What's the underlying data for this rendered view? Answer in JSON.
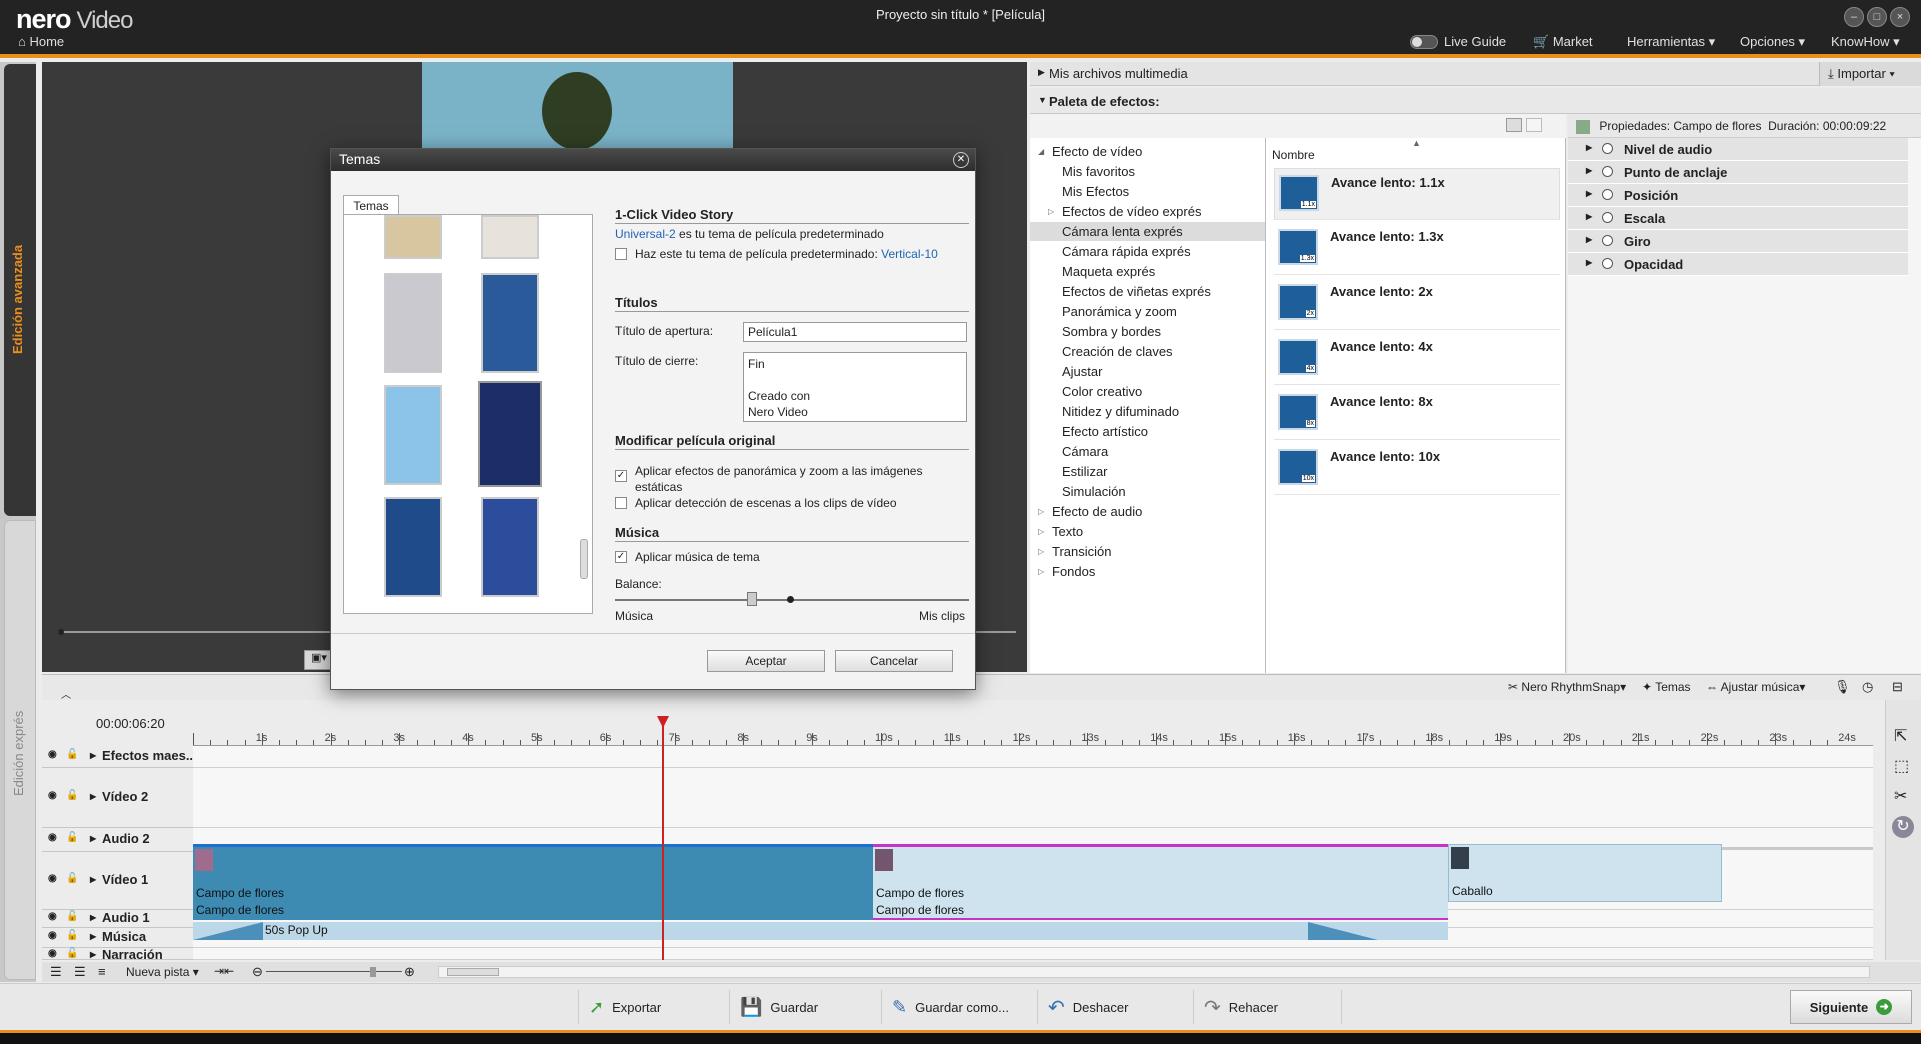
{
  "app": {
    "brand": "nero",
    "product": "Video",
    "home": "Home",
    "window_title": "Proyecto sin título * [Película]"
  },
  "topbar": {
    "live_guide": "Live Guide",
    "market": "Market",
    "tools": "Herramientas",
    "options": "Opciones",
    "knowhow": "KnowHow"
  },
  "left_tabs": {
    "advanced": "Edición avanzada",
    "express": "Edición exprés"
  },
  "media": {
    "title": "Mis archivos multimedia",
    "import": "Importar"
  },
  "effects": {
    "palette_title": "Paleta de efectos:",
    "tree": [
      {
        "label": "Efecto de vídeo",
        "level": 0,
        "expanded": true
      },
      {
        "label": "Mis favoritos",
        "level": 1
      },
      {
        "label": "Mis Efectos",
        "level": 1
      },
      {
        "label": "Efectos de vídeo exprés",
        "level": 1,
        "expandable": true
      },
      {
        "label": "Cámara lenta exprés",
        "level": 1,
        "selected": true
      },
      {
        "label": "Cámara rápida exprés",
        "level": 1
      },
      {
        "label": "Maqueta exprés",
        "level": 1
      },
      {
        "label": "Efectos de viñetas exprés",
        "level": 1
      },
      {
        "label": "Panorámica y zoom",
        "level": 1
      },
      {
        "label": "Sombra y bordes",
        "level": 1
      },
      {
        "label": "Creación de claves",
        "level": 1
      },
      {
        "label": "Ajustar",
        "level": 1
      },
      {
        "label": "Color creativo",
        "level": 1
      },
      {
        "label": "Nitidez y difuminado",
        "level": 1
      },
      {
        "label": "Efecto artístico",
        "level": 1
      },
      {
        "label": "Cámara",
        "level": 1
      },
      {
        "label": "Estilizar",
        "level": 1
      },
      {
        "label": "Simulación",
        "level": 1
      },
      {
        "label": "Efecto de audio",
        "level": 0
      },
      {
        "label": "Texto",
        "level": 0
      },
      {
        "label": "Transición",
        "level": 0
      },
      {
        "label": "Fondos",
        "level": 0
      }
    ],
    "list_header": "Nombre",
    "items": [
      {
        "label": "Avance lento: 1.1x",
        "badge": "1.1x"
      },
      {
        "label": "Avance lento: 1.3x",
        "badge": "1.3x"
      },
      {
        "label": "Avance lento: 2x",
        "badge": "2x"
      },
      {
        "label": "Avance lento: 4x",
        "badge": "4x"
      },
      {
        "label": "Avance lento: 8x",
        "badge": "8x"
      },
      {
        "label": "Avance lento: 10x",
        "badge": "10x"
      }
    ]
  },
  "properties": {
    "title": "Propiedades: Campo de flores",
    "duration_label": "Duración:",
    "duration": "00:00:09:22",
    "rows": [
      "Nivel de audio",
      "Punto de anclaje",
      "Posición",
      "Escala",
      "Giro",
      "Opacidad"
    ]
  },
  "timeline_toolbar": {
    "rhythmsnap": "Nero RhythmSnap",
    "themes": "Temas",
    "fit_music": "Ajustar música"
  },
  "timeline": {
    "timecode": "00:00:06:20",
    "ticks": [
      "1s",
      "2s",
      "3s",
      "4s",
      "5s",
      "6s",
      "7s",
      "8s",
      "9s",
      "10s",
      "11s",
      "12s",
      "13s",
      "14s",
      "15s",
      "16s",
      "17s",
      "18s",
      "19s",
      "20s",
      "21s",
      "22s",
      "23s",
      "24s"
    ],
    "tracks": [
      "Efectos maes...",
      "Vídeo 2",
      "Audio 2",
      "Vídeo 1",
      "Audio 1",
      "Música",
      "Narración"
    ],
    "clips": {
      "v1a": "Campo de flores",
      "v1b": "Campo de flores",
      "v1c": "Caballo",
      "a1a": "Campo de flores",
      "a1b": "Campo de flores",
      "music": "50s Pop Up"
    },
    "new_track": "Nueva pista"
  },
  "bottom": {
    "export": "Exportar",
    "save": "Guardar",
    "save_as": "Guardar como...",
    "undo": "Deshacer",
    "redo": "Rehacer",
    "next": "Siguiente"
  },
  "dialog": {
    "title": "Temas",
    "tab": "Temas",
    "story_title": "1-Click Video Story",
    "default_theme": "Universal-2",
    "default_text": "es tu tema de película predeterminado",
    "make_default_text": "Haz este tu tema de película predeterminado:",
    "make_default_theme": "Vertical-10",
    "titles_title": "Títulos",
    "opening_label": "Título de apertura:",
    "opening_value": "Película1",
    "closing_label": "Título de cierre:",
    "closing_line1": "Fin",
    "closing_line2": "Creado con",
    "closing_line3": "Nero Video",
    "modify_title": "Modificar película original",
    "pan_zoom_line1": "Aplicar efectos de panorámica y zoom a las imágenes",
    "pan_zoom_line2": "estáticas",
    "scene_detect": "Aplicar detección de escenas a los clips de vídeo",
    "music_title": "Música",
    "apply_music": "Aplicar música de tema",
    "balance": "Balance:",
    "balance_left": "Música",
    "balance_right": "Mis clips",
    "accept": "Aceptar",
    "cancel": "Cancelar"
  }
}
